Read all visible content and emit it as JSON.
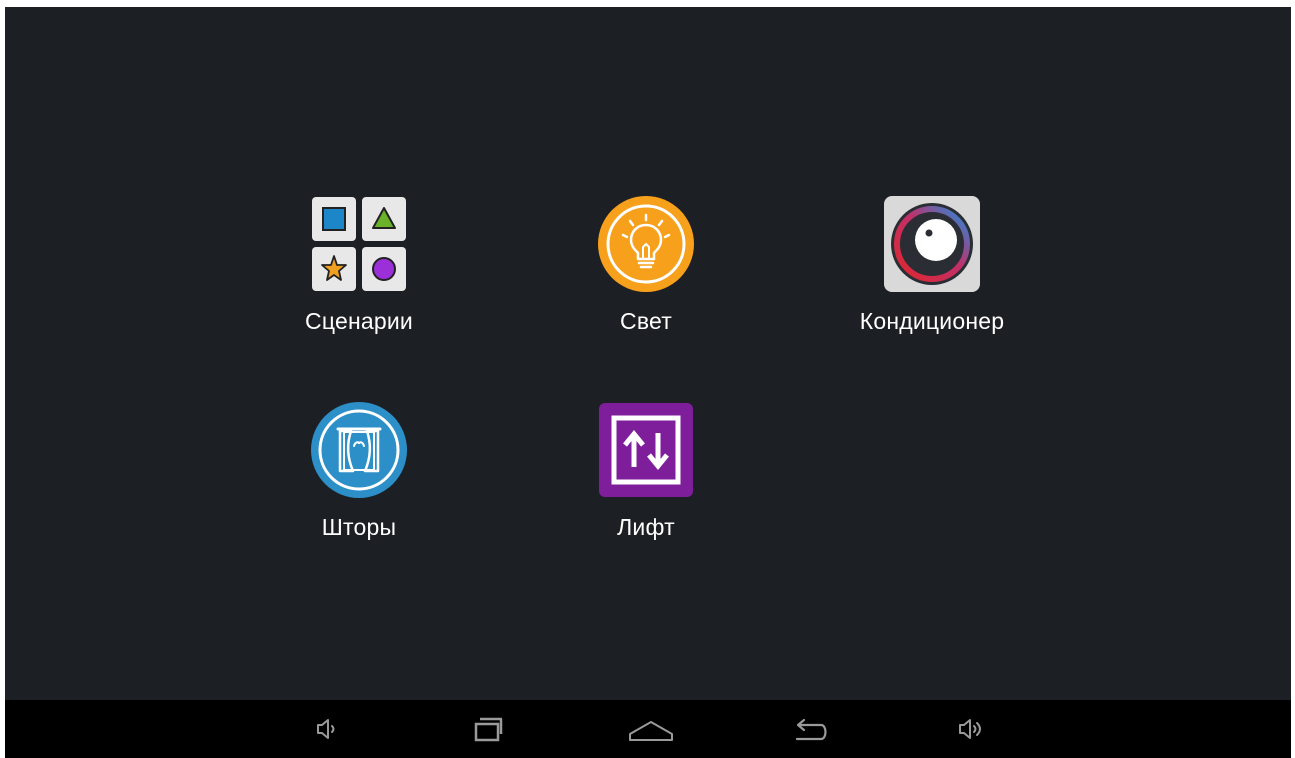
{
  "apps": [
    {
      "id": "scenarios",
      "label": "Сценарии",
      "icon": "scenarios-icon"
    },
    {
      "id": "light",
      "label": "Свет",
      "icon": "lightbulb-icon"
    },
    {
      "id": "climate",
      "label": "Кондиционер",
      "icon": "thermostat-dial-icon"
    },
    {
      "id": "curtains",
      "label": "Шторы",
      "icon": "curtains-icon"
    },
    {
      "id": "elevator",
      "label": "Лифт",
      "icon": "elevator-arrows-icon"
    }
  ],
  "navbar": {
    "buttons": [
      "volume-down-icon",
      "recent-apps-icon",
      "home-icon",
      "back-icon",
      "volume-up-icon"
    ]
  },
  "colors": {
    "background": "#1c1f23",
    "navbar": "#000000",
    "light_accent": "#f7a01c",
    "curtains_accent": "#2d8fc8",
    "elevator_accent": "#7f1e9a",
    "scenario_square": "#1d86c8",
    "scenario_triangle": "#69b22a",
    "scenario_star": "#f0a020",
    "scenario_circle": "#9b2fd8"
  }
}
